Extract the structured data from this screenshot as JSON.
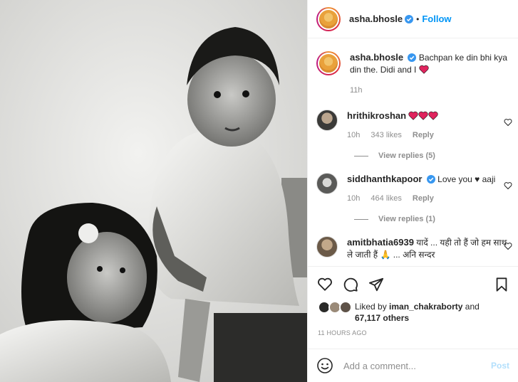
{
  "post": {
    "username": "asha.bhosle",
    "follow_label": "Follow",
    "dot": "•",
    "caption": {
      "username": "asha.bhosle",
      "text": "Bachpan ke din bhi kya din the. Didi and I",
      "time": "11h"
    }
  },
  "comments": [
    {
      "username": "hrithikroshan",
      "text": "",
      "time": "10h",
      "likes": "343 likes",
      "reply_label": "Reply",
      "view_replies": "View replies (5)"
    },
    {
      "username": "siddhanthkapoor",
      "text": "Love you ♥ aaji",
      "time": "10h",
      "likes": "464 likes",
      "reply_label": "Reply",
      "view_replies": "View replies (1)"
    },
    {
      "username": "amitbhatia6939",
      "text": "यादें ... यही तो हैं जो हम साथ ले जाती हैं 🙏 ... अनि सन्दर"
    }
  ],
  "likes": {
    "prefix": "Liked by",
    "by_user": "iman_chakraborty",
    "and": "and",
    "count": "67,117 others"
  },
  "timestamp": "11 HOURS AGO",
  "add_comment": {
    "placeholder": "Add a comment...",
    "post_label": "Post"
  },
  "colors": {
    "link_blue": "#0095f6",
    "verified_blue": "#3897f0",
    "heart_red": "#ed4956",
    "muted": "#8e8e8e"
  }
}
